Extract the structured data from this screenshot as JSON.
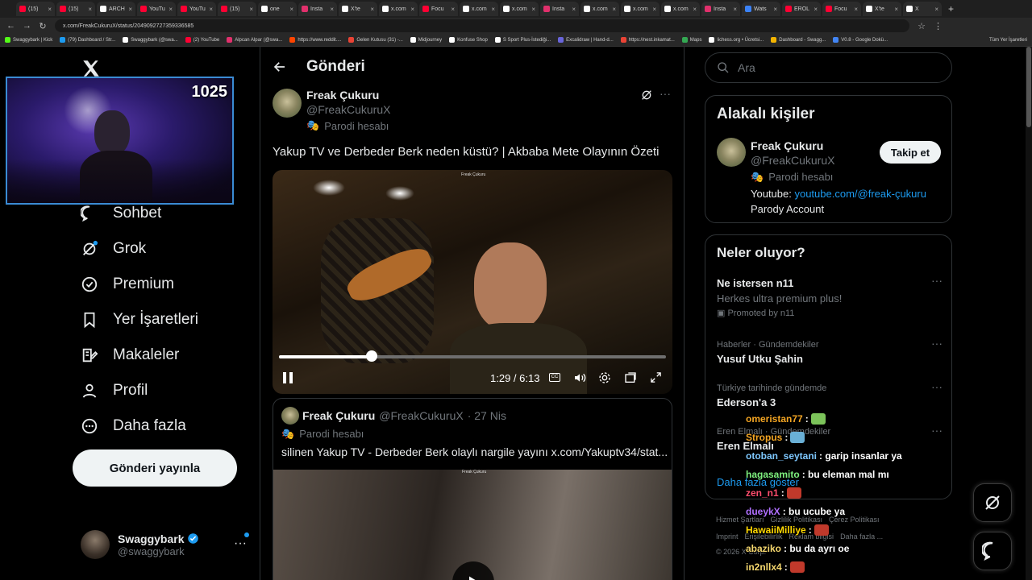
{
  "browser": {
    "tabs": [
      {
        "label": "(15) ",
        "color": "#ff0033"
      },
      {
        "label": "(15) ",
        "color": "#ff0033"
      },
      {
        "label": "ARCH",
        "color": "#ffffff"
      },
      {
        "label": "YouTu",
        "color": "#ff0033"
      },
      {
        "label": "YouTu",
        "color": "#ff0033"
      },
      {
        "label": "(15) ",
        "color": "#ff0033"
      },
      {
        "label": "one ",
        "color": "#ffffff"
      },
      {
        "label": "Insta",
        "color": "#e1306c"
      },
      {
        "label": "X'te ",
        "color": "#ffffff"
      },
      {
        "label": "x.com",
        "color": "#ffffff"
      },
      {
        "label": "Focu",
        "color": "#ff0033"
      },
      {
        "label": "x.com",
        "color": "#ffffff"
      },
      {
        "label": "x.com",
        "color": "#ffffff"
      },
      {
        "label": "Insta",
        "color": "#e1306c"
      },
      {
        "label": "x.com",
        "color": "#ffffff"
      },
      {
        "label": "x.com",
        "color": "#ffffff"
      },
      {
        "label": "x.com",
        "color": "#ffffff"
      },
      {
        "label": "Insta",
        "color": "#e1306c"
      },
      {
        "label": "Wats",
        "color": "#3b82f6"
      },
      {
        "label": "EROL",
        "color": "#ff0033"
      },
      {
        "label": "Focu",
        "color": "#ff0033"
      },
      {
        "label": "X'te ",
        "color": "#ffffff"
      },
      {
        "label": "X",
        "color": "#ffffff"
      }
    ],
    "url": "x.com/FreakCukuruX/status/2049092727359336585",
    "bookmarks": [
      {
        "label": "Swaggybark | Kick",
        "color": "#53fc18"
      },
      {
        "label": "(79) Dashboard / Str...",
        "color": "#1d9bf0"
      },
      {
        "label": "Swaggybark (@swa...",
        "color": "#ffffff"
      },
      {
        "label": "(2) YouTube",
        "color": "#ff0033"
      },
      {
        "label": "Alpcan Alpar (@swa...",
        "color": "#e1306c"
      },
      {
        "label": "https://www.reddit....",
        "color": "#ff4500"
      },
      {
        "label": "Gelen Kutusu (31) -...",
        "color": "#ea4335"
      },
      {
        "label": "Midjourney",
        "color": "#ffffff"
      },
      {
        "label": "Konfuse Shop",
        "color": "#ffffff"
      },
      {
        "label": "S Sport Plus-İstediği...",
        "color": "#ffffff"
      },
      {
        "label": "Excalidraw | Hand-d...",
        "color": "#6965db"
      },
      {
        "label": "https://nest.inkamat...",
        "color": "#ea4335"
      },
      {
        "label": "Maps",
        "color": "#34a853"
      },
      {
        "label": "lichess.org • Ücretsi...",
        "color": "#ffffff"
      },
      {
        "label": "Dashboard - Swagg...",
        "color": "#f4b400"
      },
      {
        "label": "V0.8 - Google Dokü...",
        "color": "#4285f4"
      }
    ],
    "bookmarks_all": "Tüm Yer İşaretleri"
  },
  "webcam": {
    "counter": "1025"
  },
  "nav": {
    "items": [
      {
        "label": "Sohbet",
        "icon": "chat-icon"
      },
      {
        "label": "Grok",
        "icon": "grok-icon"
      },
      {
        "label": "Premium",
        "icon": "verified-icon"
      },
      {
        "label": "Yer İşaretleri",
        "icon": "bookmark-icon"
      },
      {
        "label": "Makaleler",
        "icon": "articles-icon"
      },
      {
        "label": "Profil",
        "icon": "profile-icon"
      },
      {
        "label": "Daha fazla",
        "icon": "more-icon"
      }
    ],
    "post_button": "Gönderi yayınla",
    "user_name": "Swaggybark",
    "user_handle": "@swaggybark"
  },
  "post": {
    "header_title": "Gönderi",
    "author_name": "Freak Çukuru",
    "author_handle": "@FreakCukuruX",
    "parody_label": "Parodi hesabı",
    "text": "Yakup TV ve Derbeder Berk neden küstü? | Akbaba Mete Olayının Özeti",
    "video_watermark": "Freak Çukuru",
    "video_time": "1:29 / 6:13",
    "video_progress": 0.24,
    "quote": {
      "author_name": "Freak Çukuru",
      "author_handle": "@FreakCukuruX",
      "date": "· 27 Nis",
      "parody_label": "Parodi hesabı",
      "text": "silinen Yakup TV - Derbeder Berk olaylı nargile yayını  x.com/Yakuptv34/stat...",
      "watermark": "Freak Çukuru"
    }
  },
  "sidebar": {
    "search_placeholder": "Ara",
    "related_title": "Alakalı kişiler",
    "related_name": "Freak Çukuru",
    "related_handle": "@FreakCukuruX",
    "related_parody": "Parodi hesabı",
    "follow_button": "Takip et",
    "bio_prefix": "Youtube: ",
    "bio_link": "youtube.com/@freak-çukuru",
    "bio_line2": "Parody Account",
    "trends_title": "Neler oluyor?",
    "trends": [
      {
        "meta": "Ne istersen n11",
        "title": "",
        "sub": "Herkes ultra premium plus!",
        "promo": "Promoted by n11"
      },
      {
        "meta": "Haberler · Gündemdekiler",
        "title": "Yusuf Utku Şahin"
      },
      {
        "meta": "Türkiye tarihinde gündemde",
        "title": "Ederson'a 3"
      },
      {
        "meta": "Eren Elmalı · Gündemdekiler",
        "title": "Eren Elmalı"
      }
    ],
    "show_more": "Daha fazla göster",
    "footer_line1": [
      "Hizmet Şartları",
      "Gizlilik Politikası",
      "Çerez Politikası"
    ],
    "footer_line2": [
      "Imprint",
      "Erişilebilirlik",
      "Reklam bilgisi",
      "Daha fazla ..."
    ],
    "copyright": "© 2026 X Corp."
  },
  "chat": [
    {
      "user": "omeristan77",
      "msg": ":",
      "color": "#f5a623",
      "emote": "#7cc35a"
    },
    {
      "user": "Stropus",
      "msg": ":",
      "color": "#f5a623",
      "emote": "#6ab0d6"
    },
    {
      "user": "otoban_seytani",
      "msg": ": garip insanlar ya",
      "color": "#7ec8ff"
    },
    {
      "user": "hagasamito",
      "msg": ": bu eleman mal mı",
      "color": "#7ef07e"
    },
    {
      "user": "zen_n1",
      "msg": ":",
      "color": "#ff4d6d",
      "emote": "#c0392b"
    },
    {
      "user": "dueykX",
      "msg": ": bu ucube ya",
      "color": "#b070ff"
    },
    {
      "user": "HawaiiMilliye",
      "msg": ":",
      "color": "#ffd700",
      "emote": "#c0392b"
    },
    {
      "user": "abaziko",
      "msg": ": bu da ayrı oe",
      "color": "#f5d76e"
    },
    {
      "user": "in2nllx4",
      "msg": ":",
      "color": "#f5d76e",
      "emote": "#c0392b"
    }
  ]
}
